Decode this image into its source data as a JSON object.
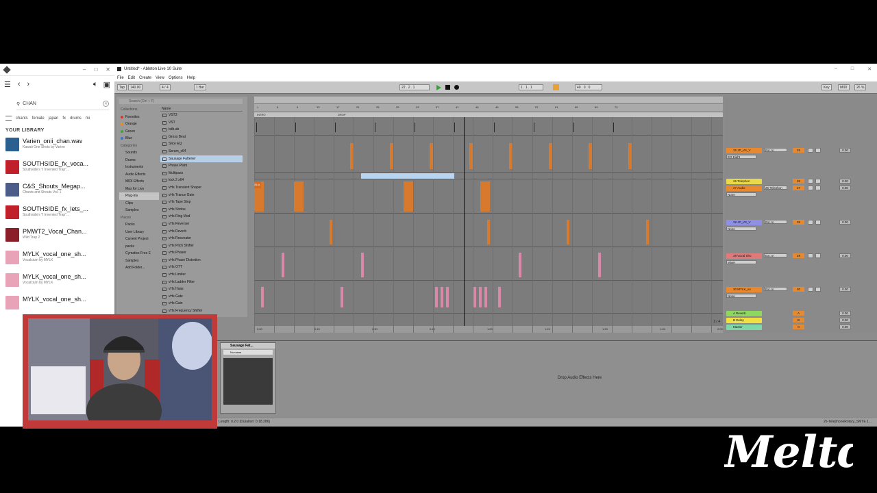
{
  "splice": {
    "window_controls": [
      "–",
      "□",
      "✕"
    ],
    "search_value": "CHAN",
    "tags": [
      "chants",
      "female",
      "japan",
      "fx",
      "drums",
      "mi"
    ],
    "library_header": "YOUR LIBRARY",
    "packs": [
      {
        "title": "Varien_onii_chan.wav",
        "subtitle": "Kawaii One Shots by Varien",
        "color": "#2b5f8f"
      },
      {
        "title": "SOUTHSIDE_fx_voca...",
        "subtitle": "Southside's \"I Invented Trap\"...",
        "color": "#c0202a"
      },
      {
        "title": "C&S_Shouts_Megap...",
        "subtitle": "Chants and Shouts Vol. 1",
        "color": "#4d5d8a"
      },
      {
        "title": "SOUTHSIDE_fx_lets_...",
        "subtitle": "Southside's \"I Invented Trap\"...",
        "color": "#c0202a"
      },
      {
        "title": "PMWT2_Vocal_Chan...",
        "subtitle": "Wild Trap 2",
        "color": "#8a1f2a"
      },
      {
        "title": "MYLK_vocal_one_sh...",
        "subtitle": "Vocalcium by MYLK",
        "color": "#e9a3b9"
      },
      {
        "title": "MYLK_vocal_one_sh...",
        "subtitle": "Vocalcium by MYLK",
        "color": "#e9a3b9"
      },
      {
        "title": "MYLK_vocal_one_sh...",
        "subtitle": "",
        "color": "#e9a3b9"
      }
    ]
  },
  "ableton": {
    "window_title": "Untitled* - Ableton Live 10 Suite",
    "window_controls": [
      "–",
      "□",
      "✕"
    ],
    "menu": [
      "File",
      "Edit",
      "Create",
      "View",
      "Options",
      "Help"
    ],
    "transport": {
      "tap": "Tap",
      "tempo": "140.00",
      "signature": "4 / 4",
      "quantize": "1 Bar",
      "position": "22 . 2 . 1",
      "loop_start": "1 . 1 . 1",
      "loop_length": "40 . 0 . 0",
      "key": "Key",
      "midi": "MIDI",
      "cpu": "26 %"
    },
    "browser": {
      "search_placeholder": "Search (Ctrl + F)",
      "collections_header": "Collections",
      "collections": [
        {
          "label": "Favorites",
          "color": "#e0332c"
        },
        {
          "label": "Orange",
          "color": "#ee8a22"
        },
        {
          "label": "Green",
          "color": "#3aa63a"
        },
        {
          "label": "Blue",
          "color": "#3a74d0"
        }
      ],
      "categories_header": "Categories",
      "categories": [
        "Sounds",
        "Drums",
        "Instruments",
        "Audio Effects",
        "MIDI Effects",
        "Max for Live",
        "Plug-ins",
        "Clips",
        "Samples"
      ],
      "selected_category": "Plug-ins",
      "places_header": "Places",
      "places": [
        "Packs",
        "User Library",
        "Current Project",
        "packs",
        "Cymatics Free E",
        "Samples",
        "Add Folder..."
      ],
      "name_header": "Name",
      "folders": [
        "VST3",
        "VST"
      ],
      "files": [
        "bdb.ab",
        "Gross Beat",
        "Slice EQ",
        "Serum_x64",
        "Sausage Fattener",
        "Phase Plant",
        "Multipass",
        "kick 2 x64",
        "vHs Transient Shaper",
        "vHs Trance Gate",
        "vHs Tape Stop",
        "vHs Strobe",
        "vHs Ring Mod",
        "vHs Reverser",
        "vHs Reverb",
        "vHs Resonator",
        "vHs Pitch Shifter",
        "vHs Phaser",
        "vHs Phase Distortion",
        "vHs OTT",
        "vHs Limiter",
        "vHs Ladder Filter",
        "vHs Haas",
        "vHs Gate",
        "vHs Gain",
        "vHs Frequency Shifter"
      ],
      "selected_file": "Sausage Fattener"
    },
    "arrangement": {
      "locators": [
        "INTRO",
        "DROP"
      ],
      "ruler_ticks": [
        "1",
        "5",
        "9",
        "13",
        "17",
        "21",
        "25",
        "29",
        "33",
        "37",
        "41",
        "45",
        "49",
        "53",
        "57",
        "61",
        "65",
        "69",
        "73"
      ],
      "time_ticks": [
        "0:00",
        "0:15",
        "0:30",
        "0:45",
        "1:00",
        "1:15",
        "1:30",
        "1:45",
        "2:00",
        "2:15"
      ],
      "clip_label": "26-A",
      "zoom_indicator": "1 / 4"
    },
    "tracks": [
      {
        "name": "25 JP_VS_V",
        "color": "#e9892f",
        "input": "Ext. In",
        "route": "EQ Eight",
        "volume": "25",
        "level": "0.00"
      },
      {
        "name": "26 Telephon",
        "color": "#e9d84a",
        "input": "",
        "route": "",
        "volume": "26",
        "level": "0.00"
      },
      {
        "name": "27 Audio",
        "color": "#e9892f",
        "input": "26-Telephon",
        "route": "None",
        "volume": "27",
        "level": "0.00"
      },
      {
        "name": "28 JP_VS_V",
        "color": "#8f8fe3",
        "input": "Ext. In",
        "route": "None",
        "volume": "28",
        "level": "0.00"
      },
      {
        "name": "29 Vocal Sho",
        "color": "#e07a7a",
        "input": "Ext. In",
        "route": "Mixer",
        "volume": "29",
        "level": "0.00"
      },
      {
        "name": "30 MYLK_vo",
        "color": "#e9892f",
        "input": "Ext. In",
        "route": "None",
        "volume": "30",
        "level": "0.00"
      }
    ],
    "returns": [
      {
        "name": "A Reverb",
        "color": "#8fd860",
        "letter": "A",
        "level": "0.00"
      },
      {
        "name": "B Delay",
        "color": "#f0e040",
        "letter": "B",
        "level": "0.00"
      },
      {
        "name": "Master",
        "color": "#7fd8a8",
        "letter": "0",
        "level": "0.00"
      }
    ],
    "master_route": "1/2",
    "device": {
      "name": "Sausage Fat...",
      "preset": "No name"
    },
    "drop_hint": "Drop Audio Effects Here",
    "status_left": "Length: 0.2.0 (Duration: 0:18.286)",
    "status_right": "26-TelephoneRotary_SMTE 1..."
  },
  "watermark": "Meltd"
}
